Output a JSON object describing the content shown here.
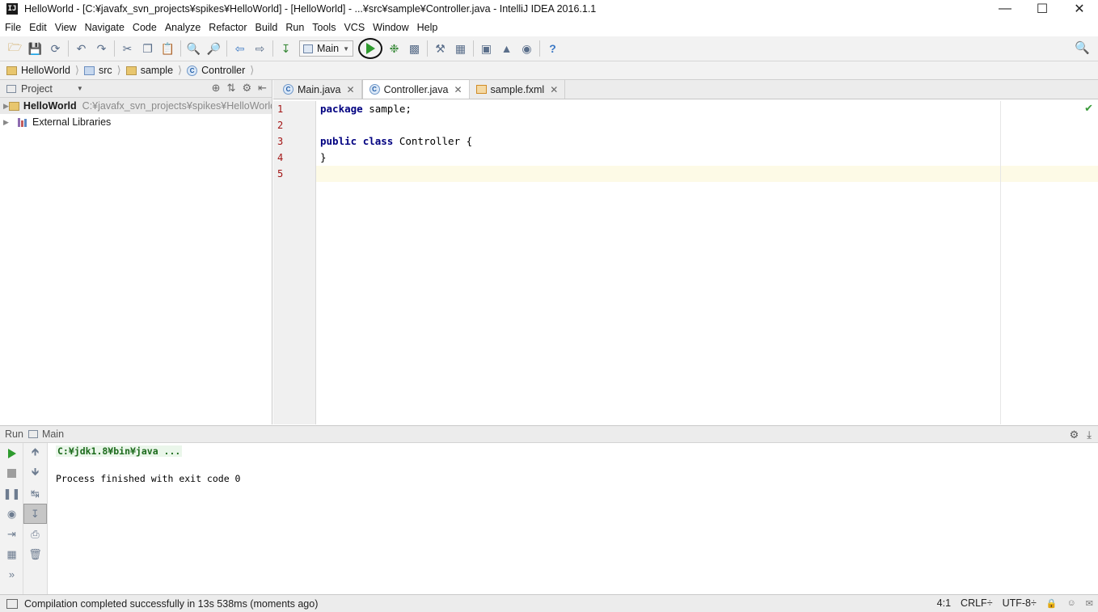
{
  "window": {
    "title": "HelloWorld - [C:¥javafx_svn_projects¥spikes¥HelloWorld] - [HelloWorld] - ...¥src¥sample¥Controller.java - IntelliJ IDEA 2016.1.1",
    "logo_text": "IJ"
  },
  "menu": {
    "items": [
      {
        "label": "File"
      },
      {
        "label": "Edit"
      },
      {
        "label": "View"
      },
      {
        "label": "Navigate"
      },
      {
        "label": "Code"
      },
      {
        "label": "Analyze"
      },
      {
        "label": "Refactor"
      },
      {
        "label": "Build"
      },
      {
        "label": "Run"
      },
      {
        "label": "Tools"
      },
      {
        "label": "VCS"
      },
      {
        "label": "Window"
      },
      {
        "label": "Help"
      }
    ]
  },
  "toolbar": {
    "run_config": "Main"
  },
  "breadcrumb": {
    "items": [
      "HelloWorld",
      "src",
      "sample",
      "Controller"
    ]
  },
  "project_panel": {
    "title": "Project",
    "tree": [
      {
        "name": "HelloWorld",
        "path": "C:¥javafx_svn_projects¥spikes¥HelloWorld"
      },
      {
        "name": "External Libraries"
      }
    ]
  },
  "editor": {
    "tabs": [
      {
        "label": "Main.java"
      },
      {
        "label": "Controller.java"
      },
      {
        "label": "sample.fxml"
      }
    ],
    "line_numbers": [
      "1",
      "2",
      "3",
      "4",
      "5"
    ],
    "code": {
      "l1_kw": "package",
      "l1_rest": " sample;",
      "l3_kw1": "public",
      "l3_kw2": "class",
      "l3_rest": " Controller {",
      "l4": "}"
    }
  },
  "run_panel": {
    "label": "Run",
    "config": "Main",
    "console": {
      "line1": "C:¥jdk1.8¥bin¥java ...",
      "line2": "Process finished with exit code 0"
    }
  },
  "status": {
    "message": "Compilation completed successfully in 13s 538ms (moments ago)",
    "position": "4:1",
    "line_sep": "CRLF÷",
    "encoding": "UTF-8÷"
  },
  "colors": {
    "run_green": "#2e9b2e",
    "keyword_navy": "#000080",
    "line_number_red": "#a31515"
  }
}
